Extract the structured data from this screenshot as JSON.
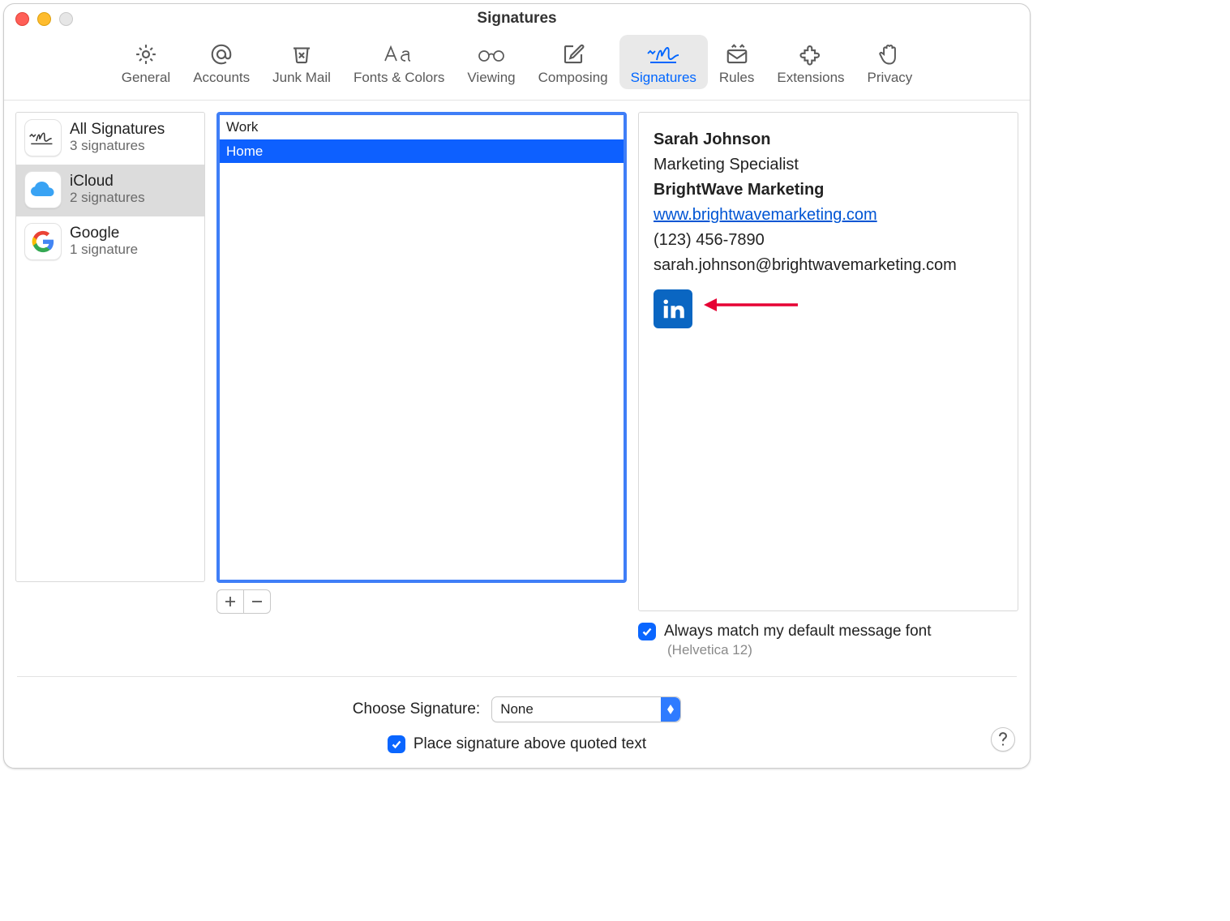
{
  "window": {
    "title": "Signatures"
  },
  "toolbar": {
    "items": [
      {
        "label": "General"
      },
      {
        "label": "Accounts"
      },
      {
        "label": "Junk Mail"
      },
      {
        "label": "Fonts & Colors"
      },
      {
        "label": "Viewing"
      },
      {
        "label": "Composing"
      },
      {
        "label": "Signatures"
      },
      {
        "label": "Rules"
      },
      {
        "label": "Extensions"
      },
      {
        "label": "Privacy"
      }
    ]
  },
  "accounts": [
    {
      "name": "All Signatures",
      "subtitle": "3 signatures"
    },
    {
      "name": "iCloud",
      "subtitle": "2 signatures"
    },
    {
      "name": "Google",
      "subtitle": "1 signature"
    }
  ],
  "signatures": [
    {
      "label": "Work"
    },
    {
      "label": "Home"
    }
  ],
  "preview": {
    "name": "Sarah Johnson",
    "role": "Marketing Specialist",
    "company": "BrightWave Marketing",
    "url": "www.brightwavemarketing.com",
    "phone": "(123) 456-7890",
    "email": "sarah.johnson@brightwavemarketing.com"
  },
  "options": {
    "match_font_label": "Always match my default message font",
    "match_font_sub": "(Helvetica 12)",
    "choose_label": "Choose Signature:",
    "choose_value": "None",
    "place_above_label": "Place signature above quoted text"
  }
}
